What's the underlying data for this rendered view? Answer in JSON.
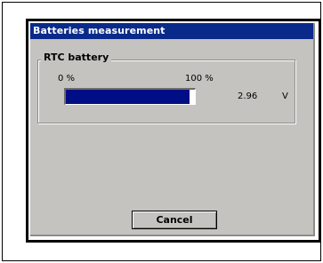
{
  "dialog": {
    "title": "Batteries measurement"
  },
  "rtc_battery": {
    "group_label": "RTC battery",
    "scale_min_label": "0 %",
    "scale_max_label": "100 %",
    "charge_fraction": 0.96,
    "voltage_value": "2.96",
    "voltage_unit": "V"
  },
  "buttons": {
    "cancel_label": "Cancel"
  },
  "colors": {
    "title_bar": "#0a2a8a",
    "window_background": "#c5c3c0",
    "progress_fill": "#000e86"
  }
}
